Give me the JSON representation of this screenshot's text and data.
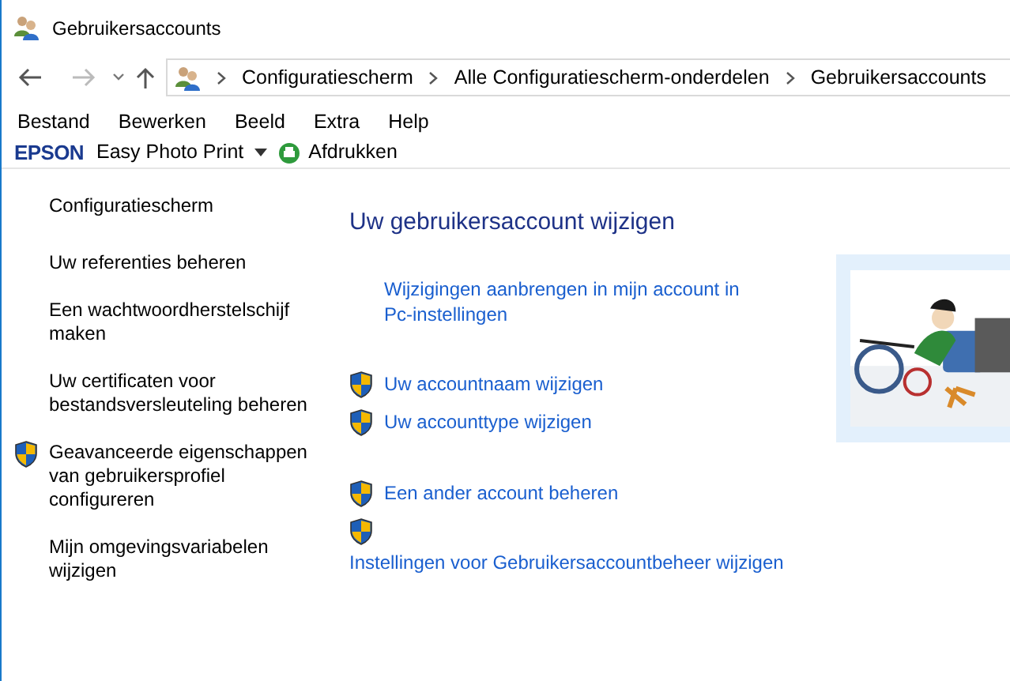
{
  "window": {
    "title": "Gebruikersaccounts"
  },
  "breadcrumb": [
    "Configuratiescherm",
    "Alle Configuratiescherm-onderdelen",
    "Gebruikersaccounts"
  ],
  "menu": [
    "Bestand",
    "Bewerken",
    "Beeld",
    "Extra",
    "Help"
  ],
  "toolbar": {
    "brand": "EPSON",
    "app": "Easy Photo Print",
    "action": "Afdrukken"
  },
  "sidebar": {
    "home": "Configuratiescherm",
    "items": [
      {
        "label": "Uw referenties beheren",
        "shield": false
      },
      {
        "label": "Een wachtwoordherstelschijf maken",
        "shield": false
      },
      {
        "label": "Uw certificaten voor bestandsversleuteling beheren",
        "shield": false
      },
      {
        "label": "Geavanceerde eigenschappen van gebruikersprofiel configureren",
        "shield": true
      },
      {
        "label": "Mijn omgevingsvariabelen wijzigen",
        "shield": false
      }
    ]
  },
  "main": {
    "heading": "Uw gebruikersaccount wijzigen",
    "groups": [
      [
        {
          "label": "Wijzigingen aanbrengen in mijn account in Pc-instellingen",
          "shield": false,
          "kind": "inline"
        }
      ],
      [
        {
          "label": "Uw accountnaam wijzigen",
          "shield": true,
          "kind": "inline"
        },
        {
          "label": "Uw accounttype wijzigen",
          "shield": true,
          "kind": "inline"
        }
      ],
      [
        {
          "label": "Een ander account beheren",
          "shield": true,
          "kind": "inline"
        },
        {
          "label": "Instellingen voor Gebruikersaccountbeheer wijzigen",
          "shield": true,
          "kind": "stacked"
        }
      ]
    ],
    "avatar": {
      "kind": "picture"
    }
  }
}
